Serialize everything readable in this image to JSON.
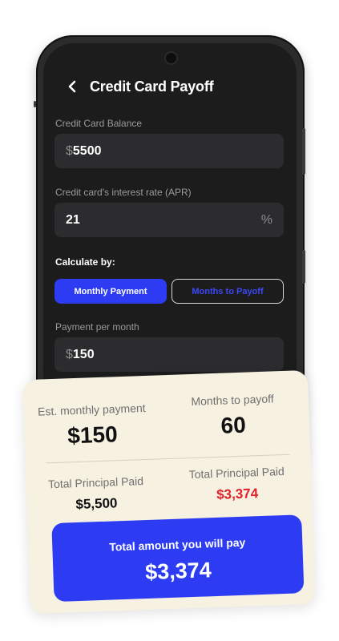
{
  "header": {
    "title": "Credit Card Payoff",
    "back_icon": "chevron-left-icon"
  },
  "form": {
    "balance": {
      "label": "Credit Card Balance",
      "prefix": "$",
      "value": "5500"
    },
    "apr": {
      "label": "Credit card's interest rate (APR)",
      "value": "21",
      "suffix": "%"
    },
    "calculate_by": {
      "label": "Calculate by:",
      "options": [
        "Monthly Payment",
        "Months to Payoff"
      ],
      "selected": "Monthly Payment"
    },
    "payment": {
      "label": "Payment per month",
      "prefix": "$",
      "value": "150"
    }
  },
  "results": {
    "monthly_payment": {
      "label": "Est. monthly payment",
      "value": "$150"
    },
    "months_to_payoff": {
      "label": "Months to payoff",
      "value": "60"
    },
    "principal_paid": {
      "label": "Total Principal Paid",
      "value": "$5,500"
    },
    "interest_paid": {
      "label": "Total Principal Paid",
      "value": "$3,374"
    },
    "total": {
      "label": "Total amount you will pay",
      "value": "$3,374"
    }
  },
  "colors": {
    "accent": "#2d3cf3",
    "background": "#1c1c1d",
    "field": "#2c2c2e",
    "card": "#f6f1e1",
    "interest": "#e0202a"
  }
}
